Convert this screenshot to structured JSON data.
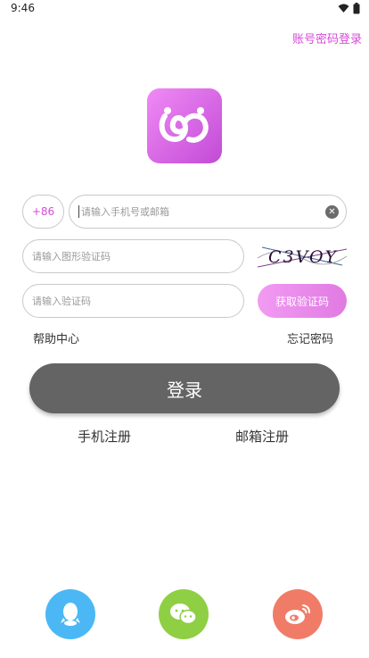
{
  "status_bar": {
    "time": "9:46"
  },
  "header": {
    "account_login_link": "账号密码登录"
  },
  "form": {
    "country_code": "+86",
    "phone_placeholder": "请输入手机号或邮箱",
    "captcha_placeholder": "请输入图形验证码",
    "captcha_text": "C3VOY",
    "code_placeholder": "请输入验证码",
    "get_code_label": "获取验证码"
  },
  "links": {
    "help": "帮助中心",
    "forgot": "忘记密码"
  },
  "login_button": "登录",
  "register": {
    "phone": "手机注册",
    "email": "邮箱注册"
  },
  "social": [
    "qq-icon",
    "wechat-icon",
    "weibo-icon"
  ],
  "colors": {
    "accent": "#d64bd8",
    "login_bg": "#646464",
    "qq": "#4bb8f5",
    "wechat": "#8fcf44",
    "weibo": "#f07c67"
  }
}
